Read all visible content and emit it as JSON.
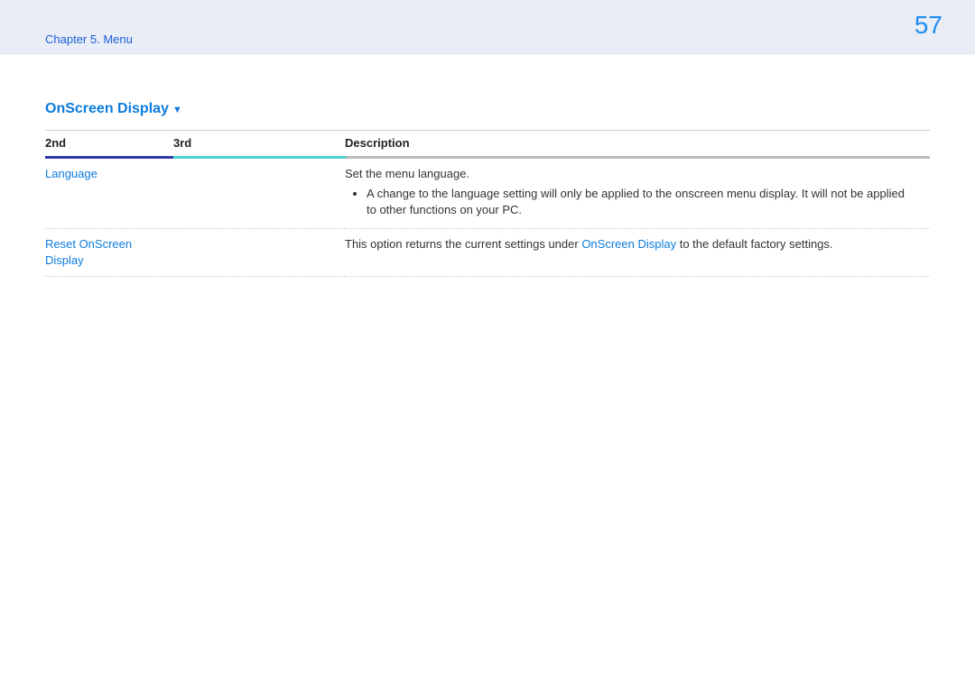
{
  "header": {
    "chapter": "Chapter 5. Menu",
    "page_number": "57"
  },
  "section": {
    "title": "OnScreen Display"
  },
  "table": {
    "columns": {
      "second": "2nd",
      "third": "3rd",
      "description": "Description"
    },
    "rows": [
      {
        "second": "Language",
        "third": "",
        "desc_lead": "Set the menu language.",
        "bullet": "A change to the language setting will only be applied to the onscreen menu display. It will not be applied to other functions on your PC."
      },
      {
        "second": "Reset OnScreen Display",
        "third": "",
        "desc_pre": "This option returns the current settings under ",
        "desc_link": "OnScreen Display",
        "desc_post": " to the default factory settings."
      }
    ]
  }
}
